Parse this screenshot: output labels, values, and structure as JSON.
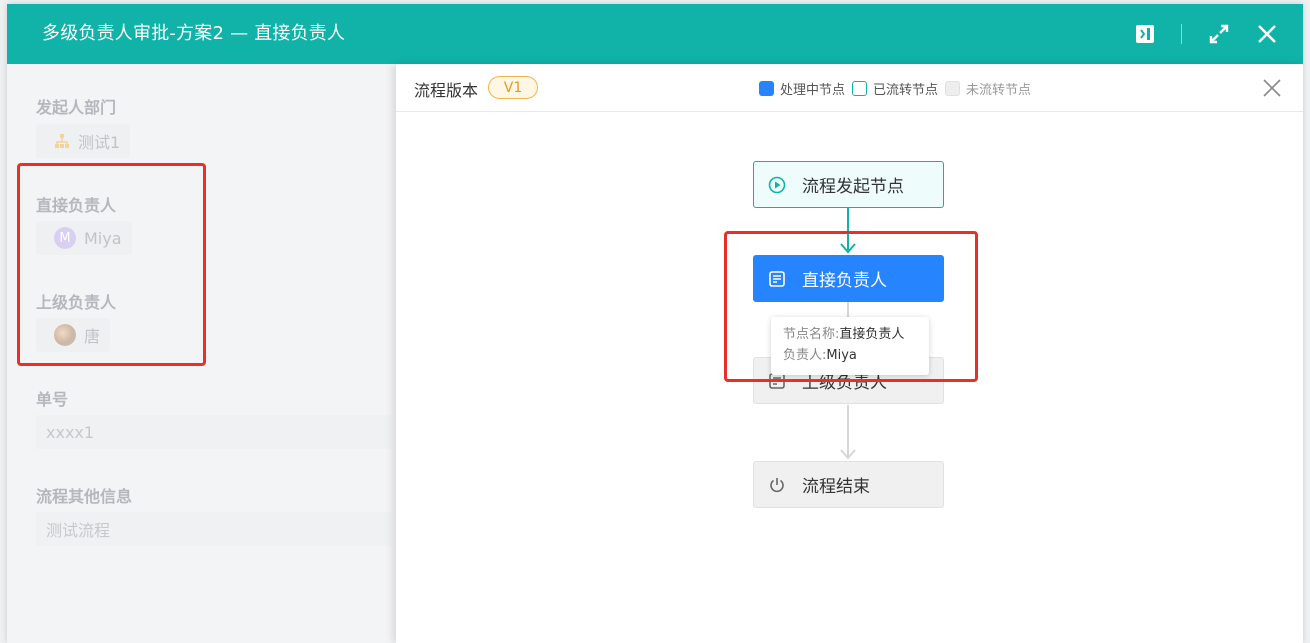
{
  "window": {
    "title": "多级负责人审批-方案2 — 直接负责人"
  },
  "form": {
    "fields": [
      {
        "label": "发起人部门",
        "value": "测试1"
      },
      {
        "label": "直接负责人",
        "value": "Miya",
        "avatar_letter": "M"
      },
      {
        "label": "上级负责人",
        "value": "唐"
      },
      {
        "label": "单号",
        "value": "xxxx1"
      },
      {
        "label": "流程其他信息",
        "value": "测试流程"
      }
    ]
  },
  "flow": {
    "version_label": "流程版本",
    "version": "V1",
    "legend": {
      "processing": "处理中节点",
      "done": "已流转节点",
      "pending": "未流转节点"
    },
    "nodes": {
      "start": "流程发起节点",
      "direct": "直接负责人",
      "upper": "上级负责人",
      "end": "流程结束"
    },
    "tooltip": {
      "name_key": "节点名称:",
      "name_value": "直接负责人",
      "owner_key": "负责人:",
      "owner_value": "Miya"
    }
  },
  "colors": {
    "header": "#11b3a8",
    "processing": "#2684ff",
    "done_border": "#11b3a8",
    "highlight": "#e8302a"
  },
  "icons": [
    "panel-toggle-icon",
    "expand-icon",
    "close-icon",
    "org-tree-icon",
    "play-circle-icon",
    "form-edit-icon",
    "power-icon"
  ]
}
